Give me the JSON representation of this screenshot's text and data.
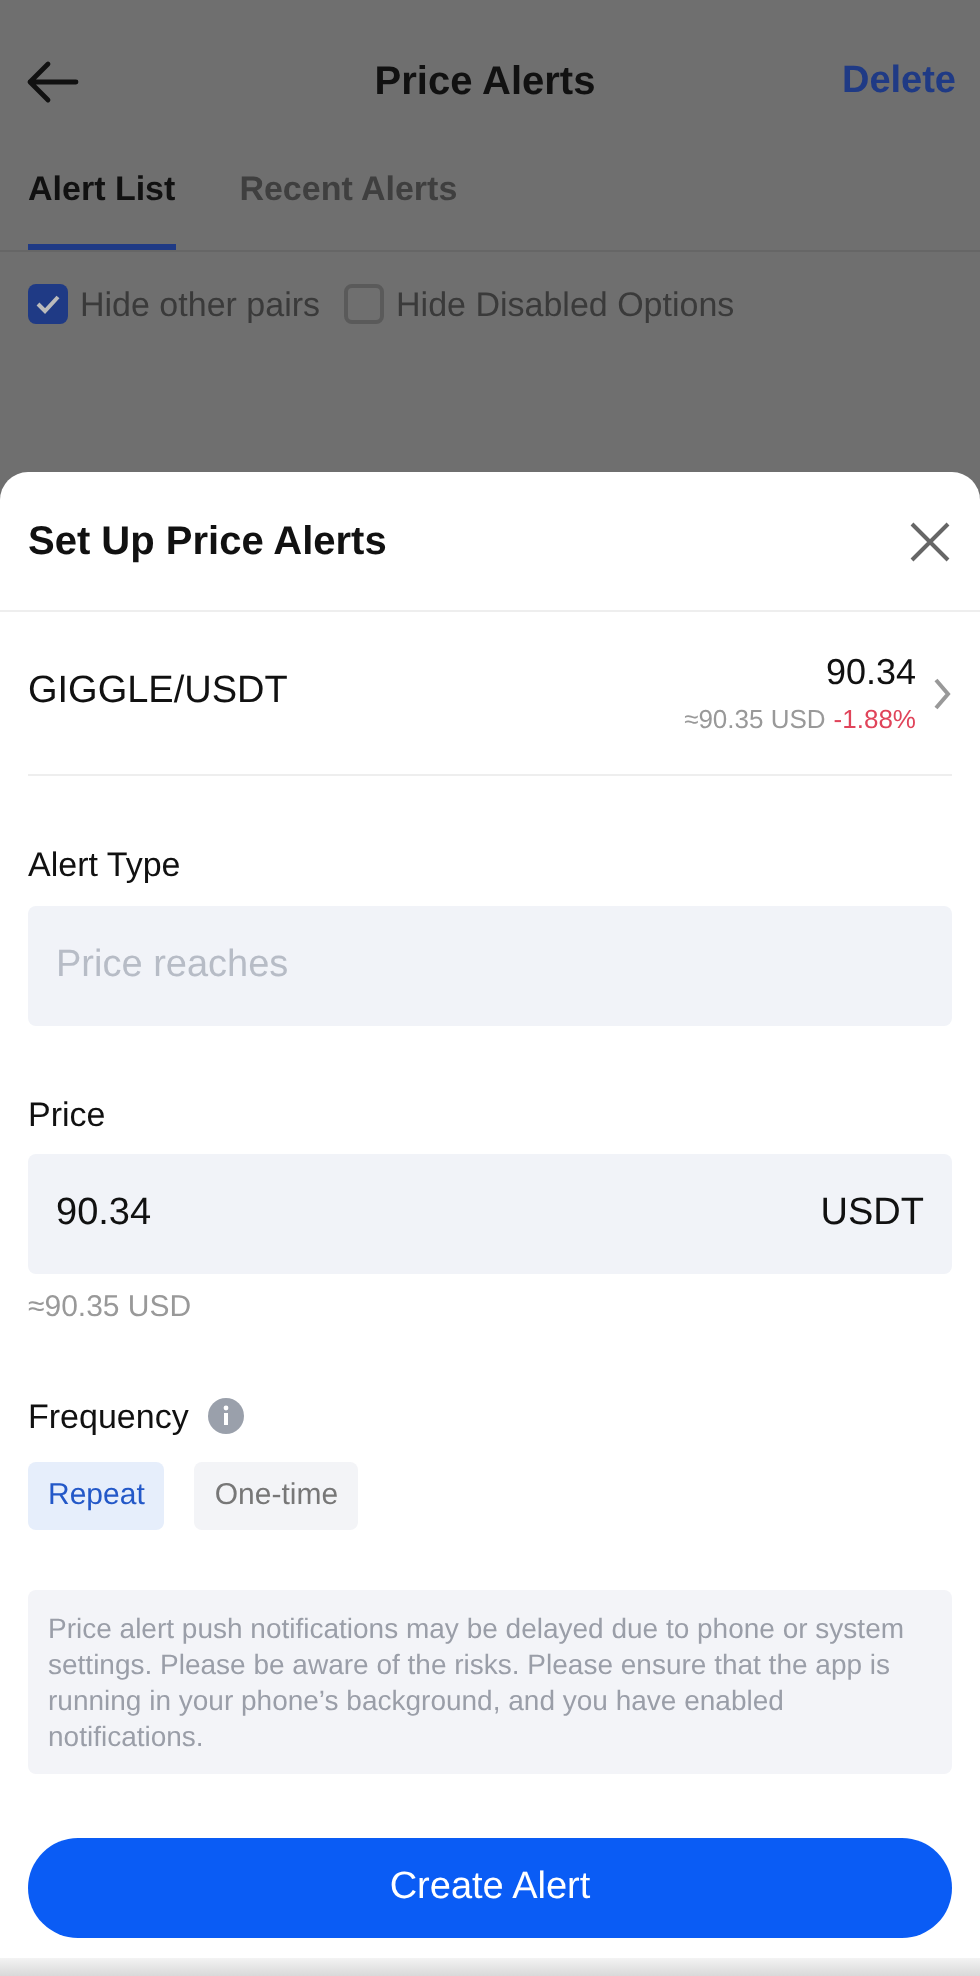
{
  "header": {
    "title": "Price Alerts",
    "action": "Delete"
  },
  "tabs": [
    {
      "label": "Alert List",
      "selected": true
    },
    {
      "label": "Recent Alerts",
      "selected": false
    }
  ],
  "filters": [
    {
      "label": "Hide other pairs",
      "checked": true
    },
    {
      "label": "Hide Disabled Options",
      "checked": false
    }
  ],
  "sheet": {
    "title": "Set Up Price Alerts",
    "pair": {
      "name": "GIGGLE/USDT",
      "price": "90.34",
      "usd": "≈90.35 USD",
      "change": "-1.88%"
    },
    "alert_type": {
      "label": "Alert Type",
      "placeholder": "Price reaches"
    },
    "price": {
      "label": "Price",
      "value": "90.34",
      "unit": "USDT",
      "usd": "≈90.35 USD"
    },
    "frequency": {
      "label": "Frequency",
      "options": [
        {
          "label": "Repeat",
          "selected": true
        },
        {
          "label": "One-time",
          "selected": false
        }
      ]
    },
    "notice": "Price alert push notifications may be delayed due to phone or system settings. Please be aware of the risks. Please ensure that the app is running in your phone’s background, and you have enabled notifications.",
    "button": "Create Alert"
  }
}
